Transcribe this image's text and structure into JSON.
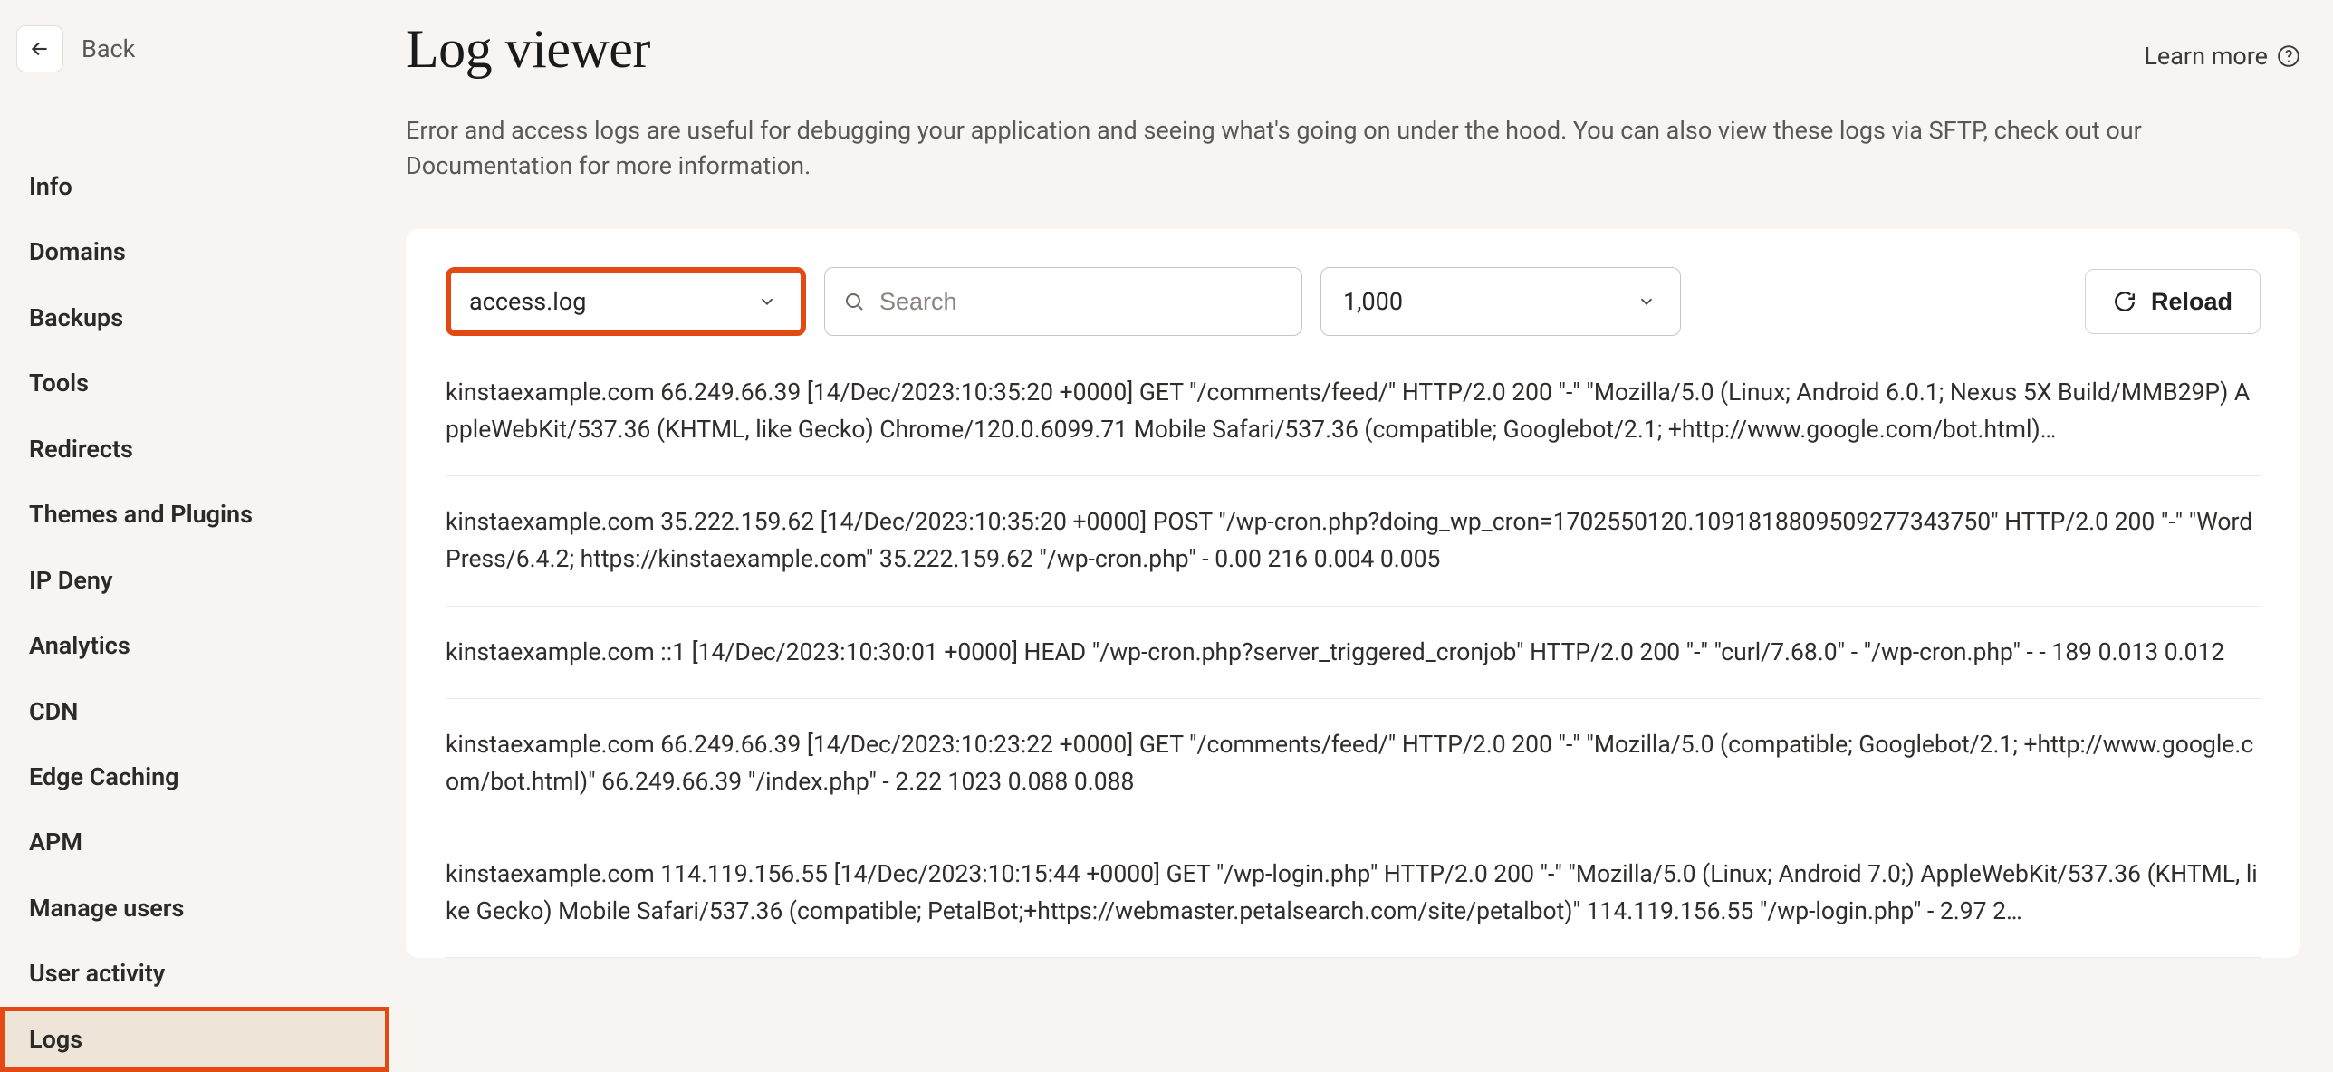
{
  "sidebar": {
    "back_label": "Back",
    "items": [
      {
        "label": "Info",
        "active": false
      },
      {
        "label": "Domains",
        "active": false
      },
      {
        "label": "Backups",
        "active": false
      },
      {
        "label": "Tools",
        "active": false
      },
      {
        "label": "Redirects",
        "active": false
      },
      {
        "label": "Themes and Plugins",
        "active": false
      },
      {
        "label": "IP Deny",
        "active": false
      },
      {
        "label": "Analytics",
        "active": false
      },
      {
        "label": "CDN",
        "active": false
      },
      {
        "label": "Edge Caching",
        "active": false
      },
      {
        "label": "APM",
        "active": false
      },
      {
        "label": "Manage users",
        "active": false
      },
      {
        "label": "User activity",
        "active": false
      },
      {
        "label": "Logs",
        "active": true
      }
    ]
  },
  "header": {
    "title": "Log viewer",
    "learn_more": "Learn more",
    "description": "Error and access logs are useful for debugging your application and seeing what's going on under the hood. You can also view these logs via SFTP, check out our Documentation for more information."
  },
  "toolbar": {
    "log_file": "access.log",
    "search_placeholder": "Search",
    "lines": "1,000",
    "reload_label": "Reload"
  },
  "logs": [
    "kinstaexample.com 66.249.66.39 [14/Dec/2023:10:35:20 +0000] GET \"/comments/feed/\" HTTP/2.0 200 \"-\" \"Mozilla/5.0 (Linux; Android 6.0.1; Nexus 5X Build/MMB29P) AppleWebKit/537.36 (KHTML, like Gecko) Chrome/120.0.6099.71 Mobile Safari/537.36 (compatible; Googlebot/2.1; +http://www.google.com/bot.html)…",
    "kinstaexample.com 35.222.159.62 [14/Dec/2023:10:35:20 +0000] POST \"/wp-cron.php?doing_wp_cron=1702550120.1091818809509277343750\" HTTP/2.0 200 \"-\" \"WordPress/6.4.2; https://kinstaexample.com\" 35.222.159.62 \"/wp-cron.php\" - 0.00 216 0.004 0.005",
    "kinstaexample.com ::1 [14/Dec/2023:10:30:01 +0000] HEAD \"/wp-cron.php?server_triggered_cronjob\" HTTP/2.0 200 \"-\" \"curl/7.68.0\" - \"/wp-cron.php\" - - 189 0.013 0.012",
    "kinstaexample.com 66.249.66.39 [14/Dec/2023:10:23:22 +0000] GET \"/comments/feed/\" HTTP/2.0 200 \"-\" \"Mozilla/5.0 (compatible; Googlebot/2.1; +http://www.google.com/bot.html)\" 66.249.66.39 \"/index.php\" - 2.22 1023 0.088 0.088",
    "kinstaexample.com 114.119.156.55 [14/Dec/2023:10:15:44 +0000] GET \"/wp-login.php\" HTTP/2.0 200 \"-\" \"Mozilla/5.0 (Linux; Android 7.0;) AppleWebKit/537.36 (KHTML, like Gecko) Mobile Safari/537.36 (compatible; PetalBot;+https://webmaster.petalsearch.com/site/petalbot)\" 114.119.156.55 \"/wp-login.php\" - 2.97 2…"
  ]
}
